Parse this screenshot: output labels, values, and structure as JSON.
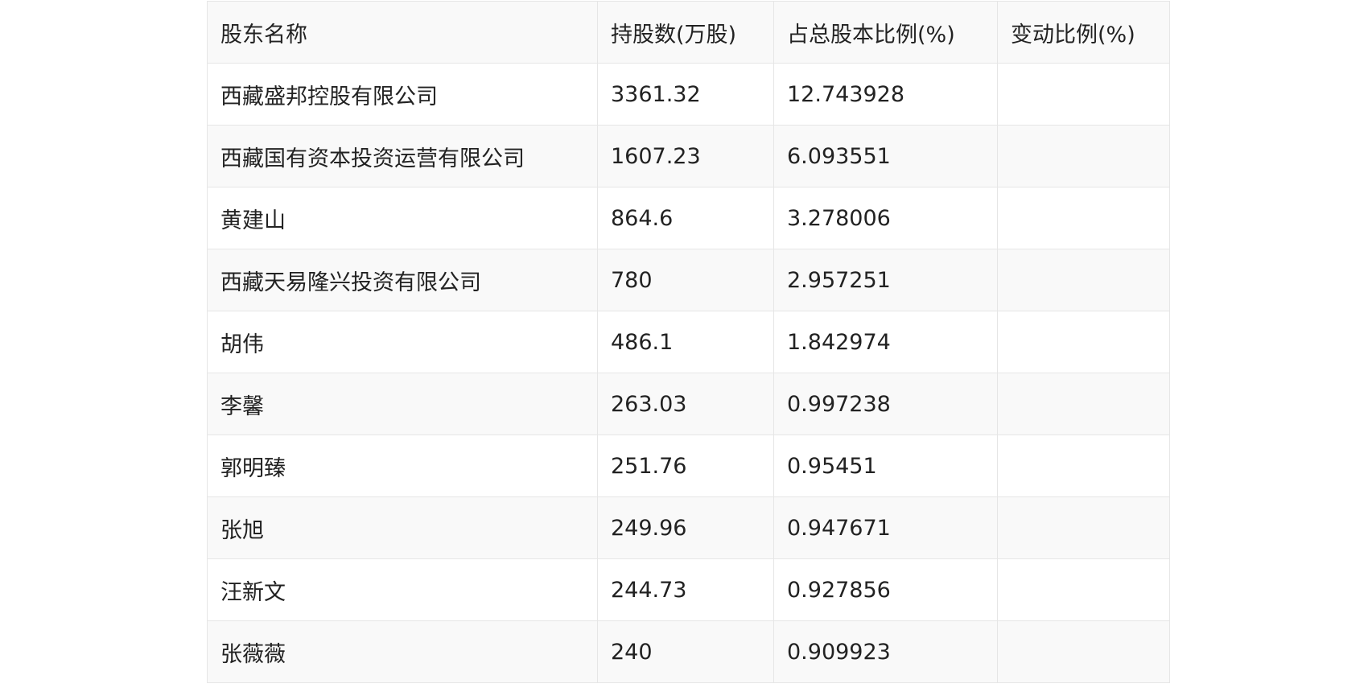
{
  "table": {
    "headers": [
      "股东名称",
      "持股数(万股)",
      "占总股本比例(%)",
      "变动比例(%)"
    ],
    "rows": [
      [
        "西藏盛邦控股有限公司",
        "3361.32",
        "12.743928",
        ""
      ],
      [
        "西藏国有资本投资运营有限公司",
        "1607.23",
        "6.093551",
        ""
      ],
      [
        "黄建山",
        "864.6",
        "3.278006",
        ""
      ],
      [
        "西藏天易隆兴投资有限公司",
        "780",
        "2.957251",
        ""
      ],
      [
        "胡伟",
        "486.1",
        "1.842974",
        ""
      ],
      [
        "李馨",
        "263.03",
        "0.997238",
        ""
      ],
      [
        "郭明臻",
        "251.76",
        "0.95451",
        ""
      ],
      [
        "张旭",
        "249.96",
        "0.947671",
        ""
      ],
      [
        "汪新文",
        "244.73",
        "0.927856",
        ""
      ],
      [
        "张薇薇",
        "240",
        "0.909923",
        ""
      ]
    ]
  }
}
